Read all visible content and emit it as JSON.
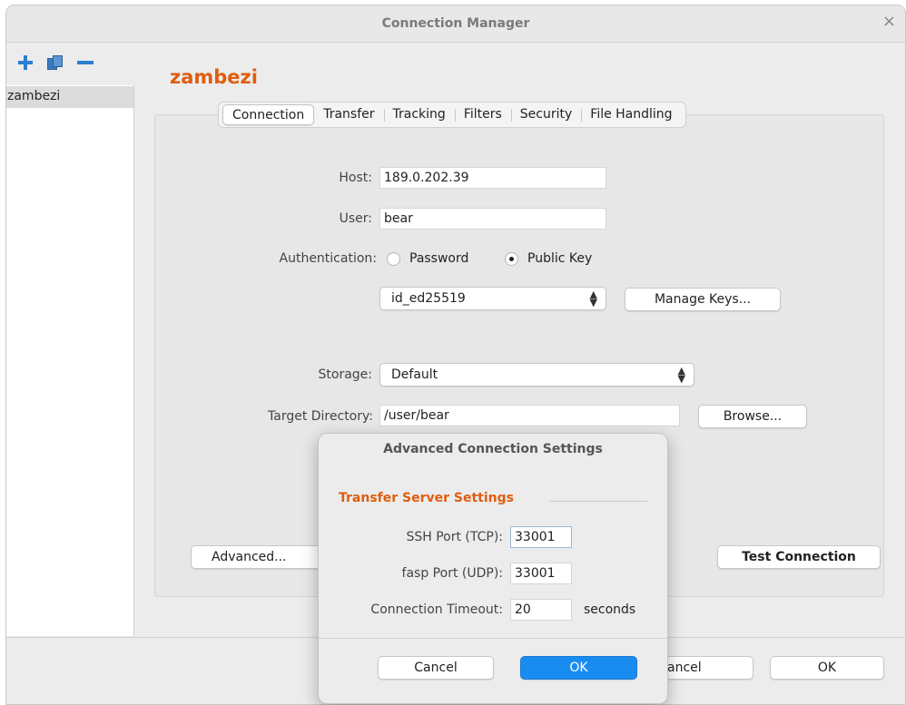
{
  "window": {
    "title": "Connection Manager",
    "close_glyph": "×"
  },
  "sidebar": {
    "toolbar": {
      "add_icon": "add-icon",
      "duplicate_icon": "duplicate-icon",
      "remove_icon": "remove-icon"
    },
    "items": [
      {
        "label": "zambezi",
        "selected": true
      }
    ]
  },
  "profile": {
    "name": "zambezi"
  },
  "tabs": [
    {
      "label": "Connection",
      "active": true
    },
    {
      "label": "Transfer",
      "active": false
    },
    {
      "label": "Tracking",
      "active": false
    },
    {
      "label": "Filters",
      "active": false
    },
    {
      "label": "Security",
      "active": false
    },
    {
      "label": "File Handling",
      "active": false
    }
  ],
  "connection": {
    "host_label": "Host:",
    "host_value": "189.0.202.39",
    "user_label": "User:",
    "user_value": "bear",
    "auth_label": "Authentication:",
    "auth_password_label": "Password",
    "auth_publickey_label": "Public Key",
    "auth_selected": "Public Key",
    "key_select_value": "id_ed25519",
    "manage_keys_label": "Manage Keys...",
    "storage_label": "Storage:",
    "storage_value": "Default",
    "target_dir_label": "Target Directory:",
    "target_dir_value": "/user/bear",
    "browse_label": "Browse...",
    "advanced_label": "Advanced...",
    "test_connection_label": "Test Connection"
  },
  "footer": {
    "cancel_label": "Cancel",
    "cancel_visible": "ancel",
    "ok_label": "OK"
  },
  "advanced_dialog": {
    "title": "Advanced Connection Settings",
    "section_title": "Transfer Server Settings",
    "ssh_port_label": "SSH Port (TCP):",
    "ssh_port_value": "33001",
    "fasp_port_label": "fasp Port (UDP):",
    "fasp_port_value": "33001",
    "timeout_label": "Connection Timeout:",
    "timeout_value": "20",
    "timeout_unit": "seconds",
    "cancel_label": "Cancel",
    "ok_label": "OK"
  },
  "colors": {
    "accent_orange": "#e05d0f",
    "primary_blue": "#1a8cf0",
    "icon_blue": "#2a7fd4"
  }
}
